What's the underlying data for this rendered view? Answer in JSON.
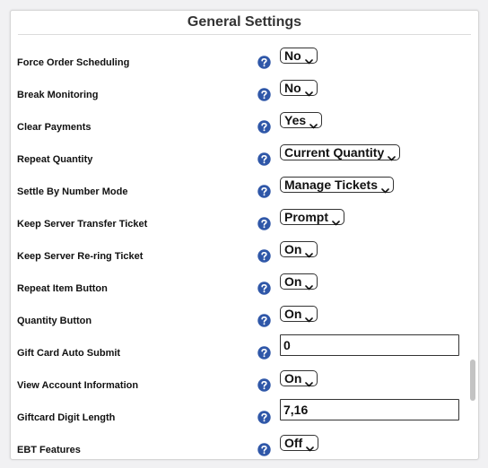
{
  "panel": {
    "title": "General Settings"
  },
  "help_icon": "question-mark-circle-icon",
  "colors": {
    "help_icon_fill": "#2f57a8",
    "scrollbar_thumb": "#c3c3c3"
  },
  "settings": [
    {
      "label": "Force Order Scheduling",
      "control": "select",
      "value": "No"
    },
    {
      "label": "Break Monitoring",
      "control": "select",
      "value": "No"
    },
    {
      "label": "Clear Payments",
      "control": "select",
      "value": "Yes"
    },
    {
      "label": "Repeat Quantity",
      "control": "select",
      "value": "Current Quantity"
    },
    {
      "label": "Settle By Number Mode",
      "control": "select",
      "value": "Manage Tickets"
    },
    {
      "label": "Keep Server Transfer Ticket",
      "control": "select",
      "value": "Prompt"
    },
    {
      "label": "Keep Server Re-ring Ticket",
      "control": "select",
      "value": "On"
    },
    {
      "label": "Repeat Item Button",
      "control": "select",
      "value": "On"
    },
    {
      "label": "Quantity Button",
      "control": "select",
      "value": "On"
    },
    {
      "label": "Gift Card Auto Submit",
      "control": "text",
      "value": "0"
    },
    {
      "label": "View Account Information",
      "control": "select",
      "value": "On"
    },
    {
      "label": "Giftcard Digit Length",
      "control": "text",
      "value": "7,16"
    },
    {
      "label": "EBT Features",
      "control": "select",
      "value": "Off"
    }
  ]
}
